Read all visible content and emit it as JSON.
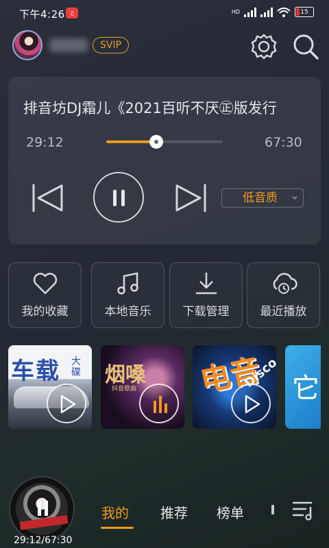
{
  "status_bar": {
    "time": "下午4:26",
    "hd": "HD",
    "battery": "15"
  },
  "header": {
    "badge": "SVIP"
  },
  "player": {
    "title": "排音坊DJ霜儿《2021百听不厌㊣版发行",
    "elapsed": "29:12",
    "total": "67:30",
    "progress": 0.43,
    "quality": "低音质"
  },
  "quick_tiles": [
    {
      "label": "我的收藏",
      "icon": "heart-icon"
    },
    {
      "label": "本地音乐",
      "icon": "music-note-icon"
    },
    {
      "label": "下载管理",
      "icon": "download-icon"
    },
    {
      "label": "最近播放",
      "icon": "cloud-history-icon"
    }
  ],
  "playlists": [
    {
      "text1": "车载",
      "text2": "大碟"
    },
    {
      "text1": "烟嗓",
      "text2": "抖音歌曲"
    },
    {
      "text1": "电音",
      "text2": "Disco"
    },
    {
      "text1": "它"
    }
  ],
  "mini_player": {
    "time": "29:12/67:30"
  },
  "nav": {
    "tabs": [
      "我的",
      "推荐",
      "榜单"
    ],
    "active": "我的"
  },
  "colors": {
    "accent": "#f29a1d",
    "svip": "#e0a021"
  }
}
